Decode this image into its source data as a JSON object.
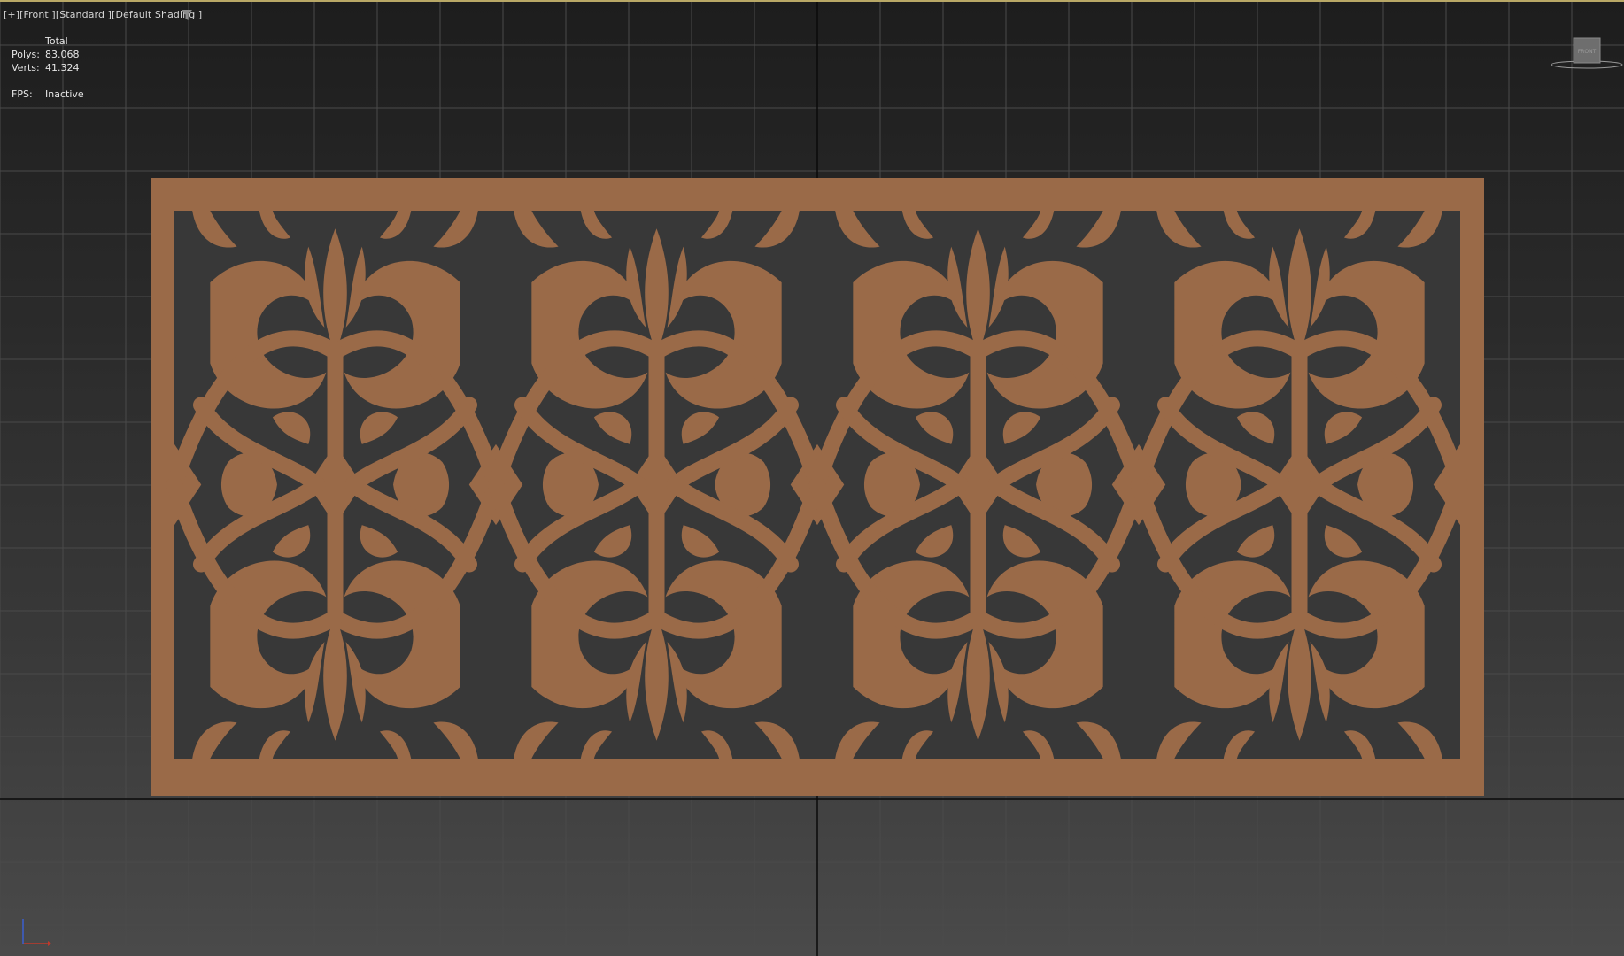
{
  "viewport": {
    "label_parts": [
      "[+]",
      "[Front ]",
      "[Standard ]",
      "[Default Shading ]"
    ],
    "filter_icon": "funnel-filter-icon"
  },
  "stats": {
    "header": "Total",
    "polys_label": "Polys:",
    "polys_value": "83.068",
    "verts_label": "Verts:",
    "verts_value": "41.324",
    "fps_label": "FPS:",
    "fps_value": "Inactive"
  },
  "viewcube": {
    "face_label": "FRONT",
    "icon": "viewcube-icon"
  },
  "axis": {
    "icon": "axis-tripod-icon",
    "x_color": "#c0392b",
    "y_color": "#3a5fd0"
  },
  "colors": {
    "panel": "#9a6a48",
    "panel_cutout": "#383838",
    "grid_line": "#4a4a4a",
    "axis_line": "#0a0a0a"
  }
}
